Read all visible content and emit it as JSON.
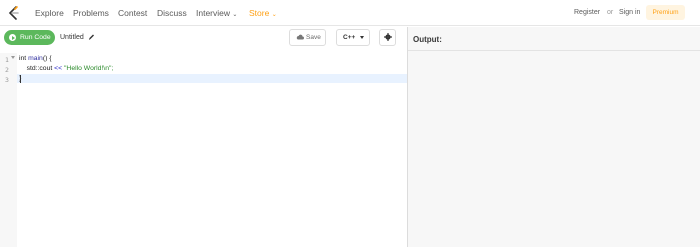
{
  "nav": {
    "items": [
      "Explore",
      "Problems",
      "Contest",
      "Discuss",
      "Interview",
      "Store"
    ],
    "register": "Register",
    "or": "or",
    "sign_in": "Sign in",
    "premium": "Premium"
  },
  "toolbar": {
    "run_label": "Run Code",
    "title": "Untitled",
    "save_label": "Save",
    "language": "C++"
  },
  "editor": {
    "line_numbers": [
      "1",
      "2",
      "3"
    ],
    "lines": [
      {
        "kw": "int ",
        "fn": "main",
        "rest": "() {"
      },
      {
        "indent": "    ",
        "ident": "std::cout ",
        "op": "<<",
        "str": " \"Hello World!\\n\";"
      },
      {
        "rest": "}"
      }
    ]
  },
  "output": {
    "label": "Output:"
  },
  "colors": {
    "brand_orange": "#ffa116",
    "run_green": "#5cb85c"
  }
}
